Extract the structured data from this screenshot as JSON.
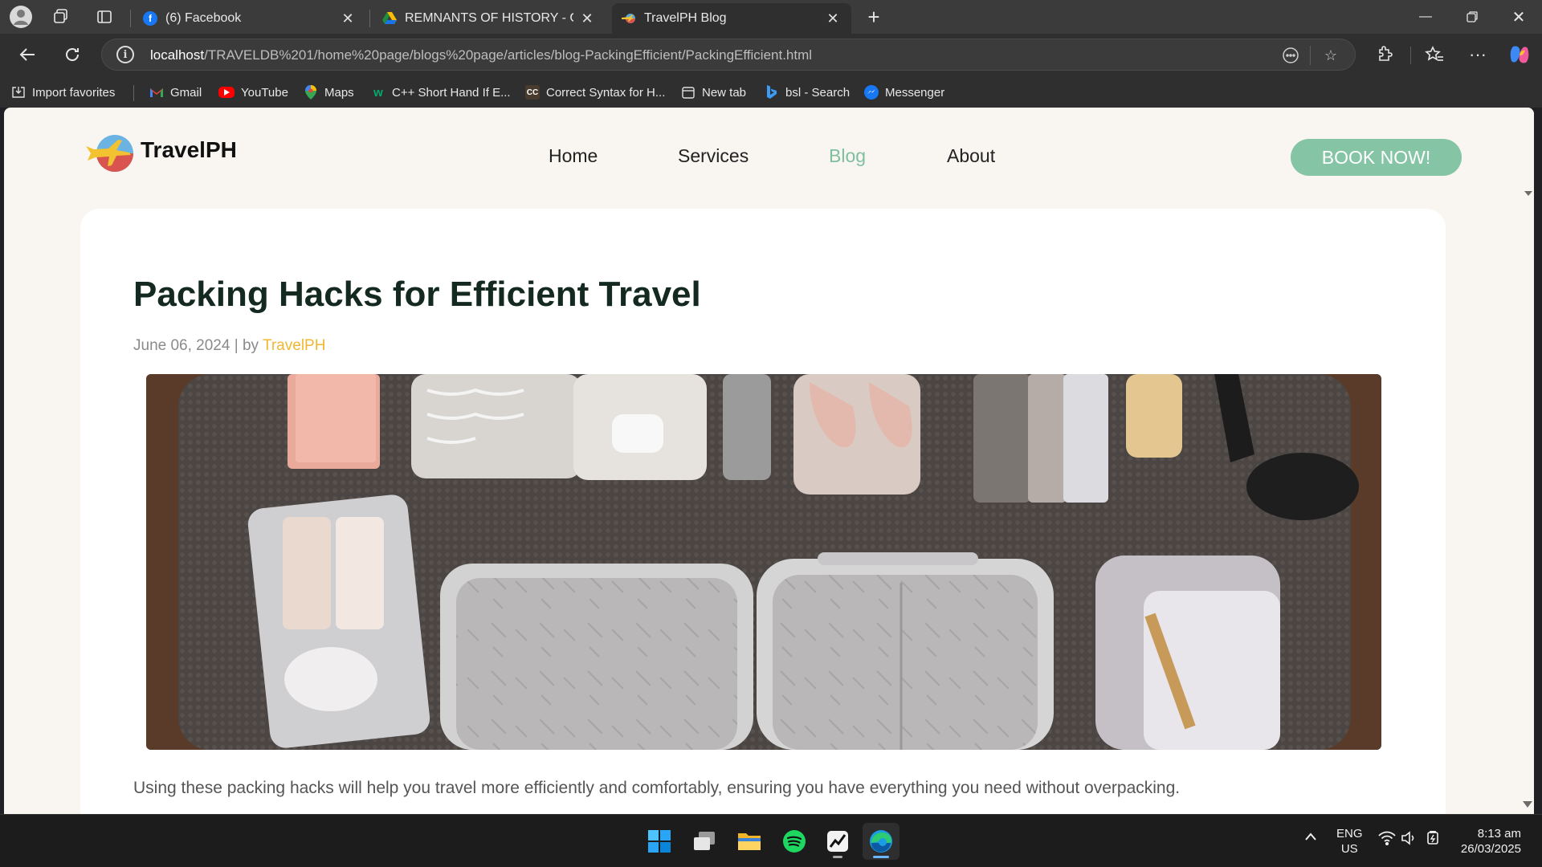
{
  "browser": {
    "tabs": [
      {
        "title": "(6) Facebook",
        "icon": "facebook-icon",
        "active": false
      },
      {
        "title": "REMNANTS OF HISTORY - Google",
        "icon": "google-drive-icon",
        "active": false
      },
      {
        "title": "TravelPH Blog",
        "icon": "travelph-plane-icon",
        "active": true
      }
    ],
    "url": {
      "host": "localhost",
      "path": "/TRAVELDB%201/home%20page/blogs%20page/articles/blog-PackingEfficient/PackingEfficient.html"
    },
    "bookmarks": [
      {
        "label": "Import favorites",
        "icon": "import-icon",
        "color": "#3b3b3b"
      },
      {
        "label": "Gmail",
        "icon": "gmail-icon",
        "color": "#ea4335"
      },
      {
        "label": "YouTube",
        "icon": "youtube-icon",
        "color": "#ff0000"
      },
      {
        "label": "Maps",
        "icon": "maps-icon",
        "color": "#34a853"
      },
      {
        "label": "C++ Short Hand If E...",
        "icon": "w3schools-icon",
        "color": "#04aa6d"
      },
      {
        "label": "Correct Syntax for H...",
        "icon": "cc-icon",
        "color": "#4a3b2f"
      },
      {
        "label": "New tab",
        "icon": "newtab-icon",
        "color": "#3b3b3b"
      },
      {
        "label": "bsl - Search",
        "icon": "bing-icon",
        "color": "#1a73e8"
      },
      {
        "label": "Messenger",
        "icon": "messenger-icon",
        "color": "#1877f2"
      }
    ]
  },
  "site": {
    "brand": "TravelPH",
    "nav": [
      {
        "label": "Home",
        "active": false
      },
      {
        "label": "Services",
        "active": false
      },
      {
        "label": "Blog",
        "active": true
      },
      {
        "label": "About",
        "active": false
      }
    ],
    "cta": "BOOK NOW!",
    "accent_color": "#85c5a6",
    "author_color": "#f2b731"
  },
  "article": {
    "title": "Packing Hacks for Efficient Travel",
    "date": "June 06, 2024",
    "by": " | by ",
    "author": "TravelPH",
    "image_alt": "suitcases and packing cubes laid out on a bed",
    "intro": "Using these packing hacks will help you travel more efficiently and comfortably, ensuring you have everything you need without overpacking."
  },
  "taskbar": {
    "apps": [
      "windows-start-icon",
      "task-view-icon",
      "file-explorer-icon",
      "spotify-icon",
      "stocks-app-icon",
      "edge-icon"
    ],
    "language": "ENG",
    "region": "US",
    "time": "8:13 am",
    "date": "26/03/2025"
  }
}
